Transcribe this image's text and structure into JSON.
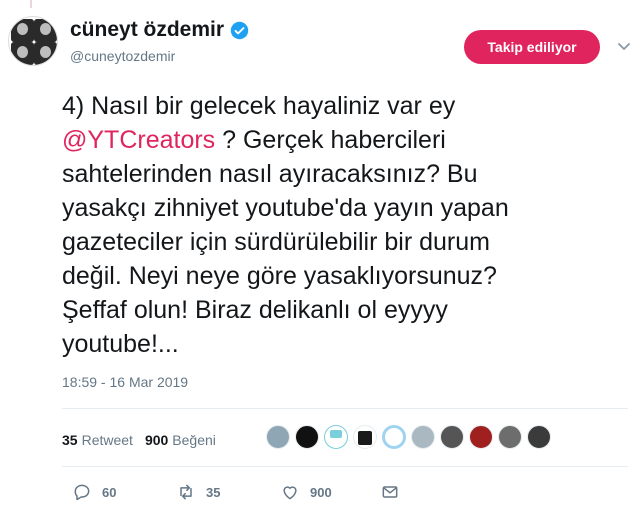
{
  "user": {
    "display_name": "cüneyt özdemir",
    "handle": "@cuneytozdemir",
    "verified": true
  },
  "follow_button": {
    "label": "Takip ediliyor",
    "color": "#e0245e"
  },
  "tweet": {
    "lines": [
      "4) Nasıl bir gelecek hayaliniz var ey",
      "@YTCreators",
      " ? Gerçek habercileri",
      "sahtelerinden nasıl ayıracaksınız? Bu",
      "yasakçı zihniyet youtube'da yayın yapan",
      "gazeteciler için sürdürülebilir bir durum",
      "değil. Neyi neye göre yasaklıyorsunuz?",
      "Şeffaf olun! Biraz delikanlı ol eyyyy",
      "youtube!..."
    ],
    "timestamp": "18:59 - 16 Mar 2019"
  },
  "stats": {
    "retweets_count": "35",
    "retweets_label": "Retweet",
    "likes_count": "900",
    "likes_label": "Beğeni"
  },
  "likers": [
    {
      "icon": "person-avatar",
      "color": "#8fa6b5"
    },
    {
      "icon": "dark-avatar",
      "color": "#111111"
    },
    {
      "icon": "cup-avatar",
      "color": "#7ad0d8"
    },
    {
      "icon": "shirt-avatar",
      "color": "#1a1a1a"
    },
    {
      "icon": "ring-avatar",
      "color": "#9fd3ef"
    },
    {
      "icon": "person-avatar",
      "color": "#aab8c2"
    },
    {
      "icon": "photo-avatar",
      "color": "#555555"
    },
    {
      "icon": "red-photo-avatar",
      "color": "#a02020"
    },
    {
      "icon": "photo-avatar",
      "color": "#6d6d6d"
    },
    {
      "icon": "bw-photo-avatar",
      "color": "#3b3b3b"
    }
  ],
  "actions": {
    "replies": "60",
    "retweets": "35",
    "likes": "900"
  },
  "colors": {
    "accent": "#e0245e",
    "text_secondary": "#657786",
    "verified": "#1da1f2"
  }
}
